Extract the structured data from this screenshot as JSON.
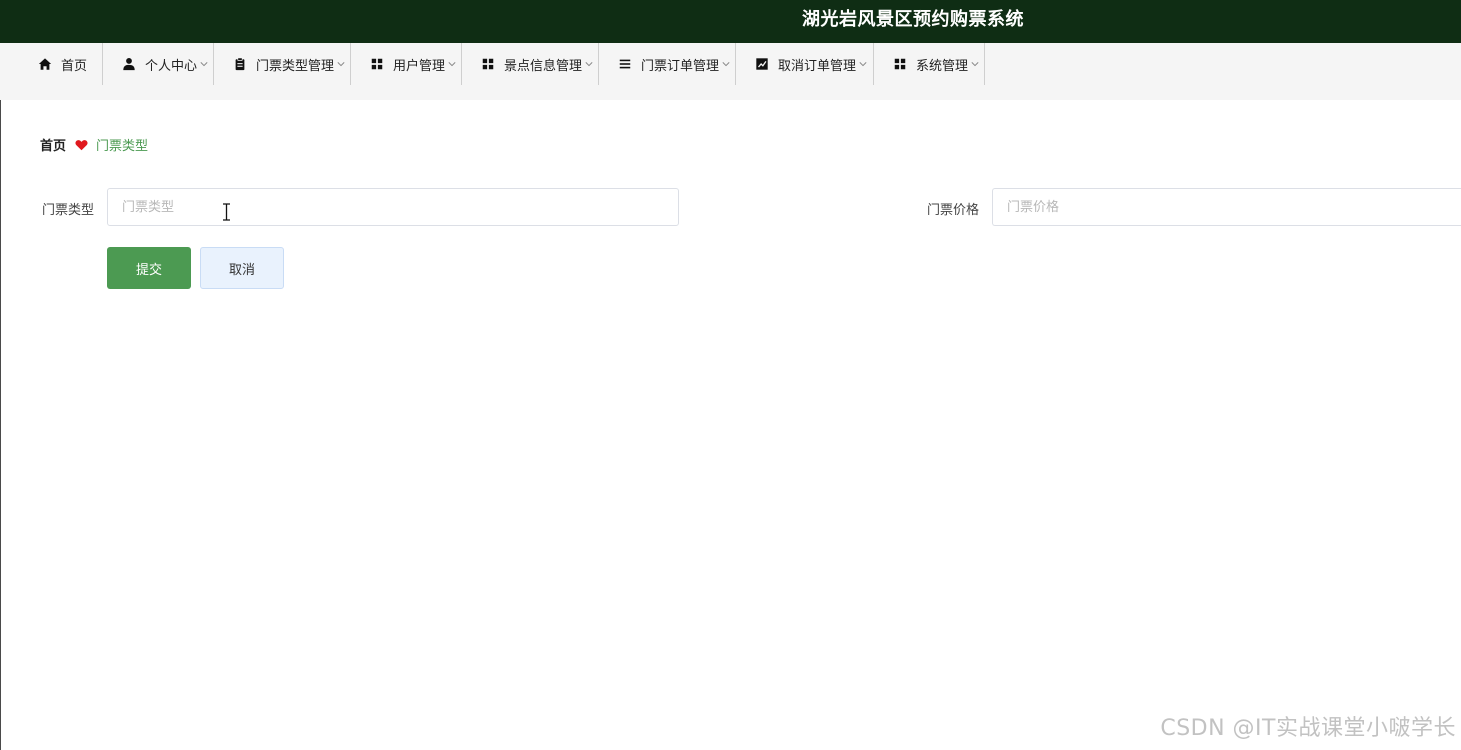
{
  "app": {
    "title": "湖光岩风景区预约购票系统"
  },
  "nav": {
    "items": [
      {
        "label": "首页",
        "icon": "home-icon",
        "has_dropdown": false
      },
      {
        "label": "个人中心",
        "icon": "user-icon",
        "has_dropdown": true
      },
      {
        "label": "门票类型管理",
        "icon": "clipboard-icon",
        "has_dropdown": true
      },
      {
        "label": "用户管理",
        "icon": "grid-icon",
        "has_dropdown": true
      },
      {
        "label": "景点信息管理",
        "icon": "grid-icon",
        "has_dropdown": true
      },
      {
        "label": "门票订单管理",
        "icon": "list-icon",
        "has_dropdown": true
      },
      {
        "label": "取消订单管理",
        "icon": "chart-icon",
        "has_dropdown": true
      },
      {
        "label": "系统管理",
        "icon": "grid-icon",
        "has_dropdown": true
      }
    ]
  },
  "breadcrumb": {
    "home": "首页",
    "separator_icon": "heart-icon",
    "current": "门票类型"
  },
  "form": {
    "ticket_type": {
      "label": "门票类型",
      "placeholder": "门票类型",
      "value": ""
    },
    "ticket_price": {
      "label": "门票价格",
      "placeholder": "门票价格",
      "value": ""
    },
    "submit_label": "提交",
    "cancel_label": "取消"
  },
  "watermark": "CSDN @IT实战课堂小啵学长",
  "colors": {
    "header_bg": "#0f2d14",
    "nav_bg": "#f5f5f5",
    "accent_green": "#4c9a52",
    "heart_red": "#e0191e",
    "cancel_bg": "#e9f2fd"
  }
}
